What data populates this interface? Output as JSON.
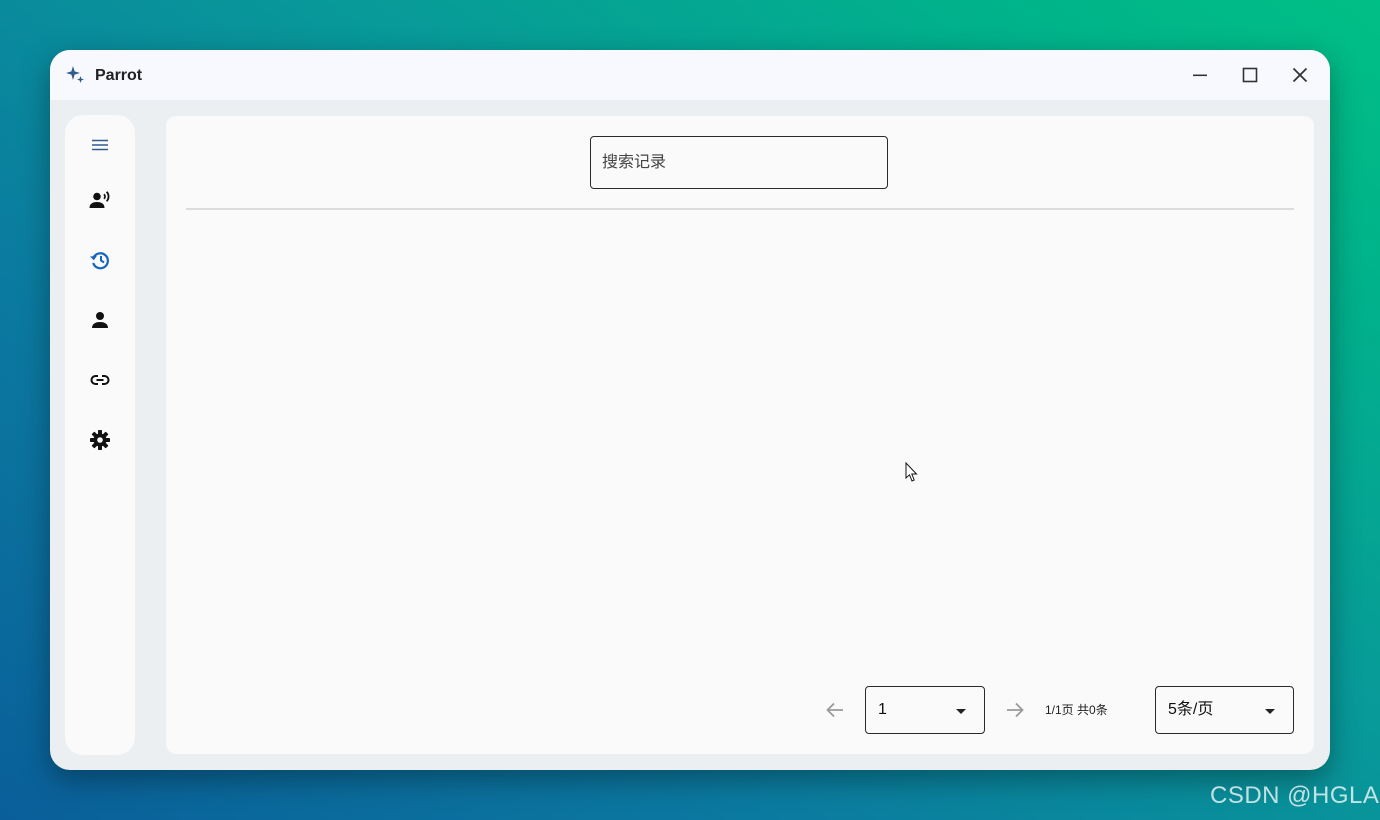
{
  "window": {
    "title": "Parrot",
    "controls": {
      "minimize": "minimize",
      "maximize": "maximize",
      "close": "close"
    }
  },
  "sidebar": {
    "accent_color": "#1565c0",
    "active_item": "history",
    "items": [
      {
        "id": "menu",
        "icon": "menu-icon"
      },
      {
        "id": "voice",
        "icon": "record-voice-icon"
      },
      {
        "id": "history",
        "icon": "history-icon"
      },
      {
        "id": "user",
        "icon": "person-icon"
      },
      {
        "id": "link",
        "icon": "link-icon"
      },
      {
        "id": "settings",
        "icon": "gear-icon"
      }
    ]
  },
  "search": {
    "placeholder": "搜索记录",
    "value": ""
  },
  "pagination": {
    "page_select_value": "1",
    "page_info": "1/1页 共0条",
    "page_size_value": "5条/页"
  },
  "watermark": "CSDN @HGLA"
}
